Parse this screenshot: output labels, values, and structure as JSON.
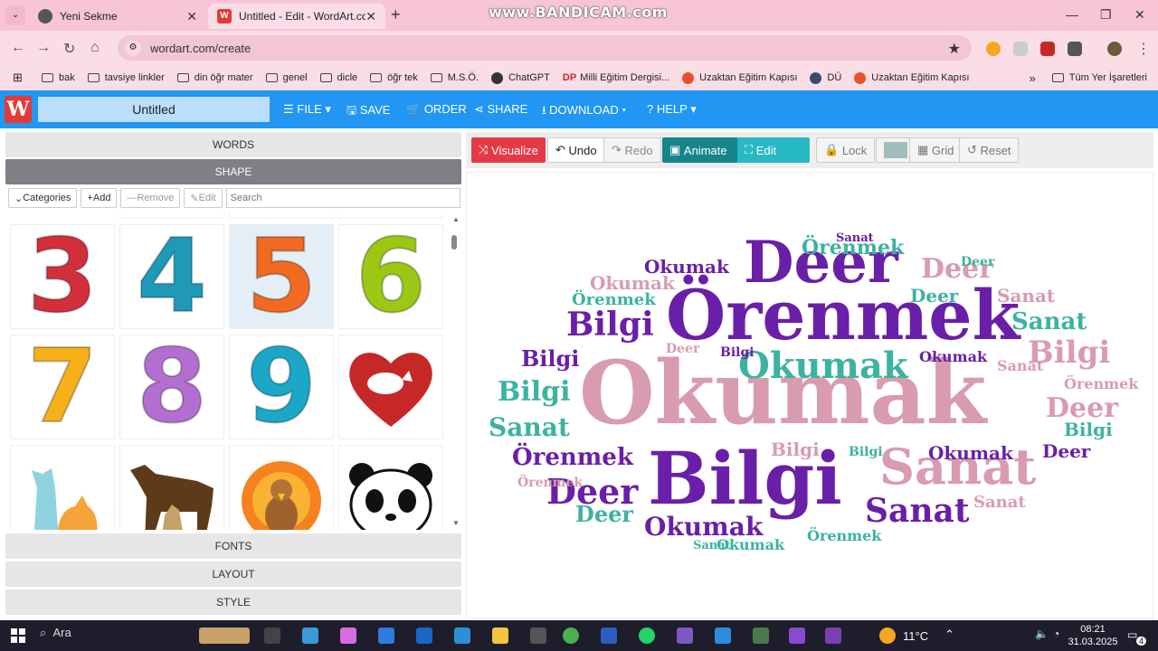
{
  "browser": {
    "tabs": [
      {
        "title": "Yeni Sekme"
      },
      {
        "title": "Untitled - Edit - WordArt.com"
      }
    ],
    "watermark": "www.BANDICAM.com",
    "url": "wordart.com/create",
    "bookmarks": [
      "bak",
      "tavsiye linkler",
      "din öğr mater",
      "genel",
      "dicle",
      "öğr tek",
      "M.S.Ö.",
      "ChatGPT",
      "Milli Eğitim Dergisi...",
      "Uzaktan Eğitim Kapısı",
      "DÜ",
      "Uzaktan Eğitim Kapısı"
    ],
    "all_bookmarks": "Tüm Yer İşaretleri"
  },
  "app": {
    "logo": "W",
    "title": "Untitled",
    "menu": [
      "FILE",
      "SAVE",
      "ORDER",
      "SHARE",
      "DOWNLOAD",
      "HELP"
    ]
  },
  "left": {
    "sections": {
      "words": "WORDS",
      "shape": "SHAPE",
      "fonts": "FONTS",
      "layout": "LAYOUT",
      "style": "STYLE"
    },
    "toolbar": {
      "categories": "Categories",
      "add": "Add",
      "remove": "Remove",
      "edit": "Edit",
      "search_placeholder": "Search"
    },
    "shapes": [
      {
        "glyph": "3",
        "color": "#d32f3a"
      },
      {
        "glyph": "4",
        "color": "#1e9ab8"
      },
      {
        "glyph": "5",
        "color": "#f26a22"
      },
      {
        "glyph": "6",
        "color": "#9cc715"
      },
      {
        "glyph": "7",
        "color": "#f5b01a"
      },
      {
        "glyph": "8",
        "color": "#b36ed1"
      },
      {
        "glyph": "9",
        "color": "#1aa7c8"
      }
    ]
  },
  "right": {
    "toolbar": {
      "visualize": "Visualize",
      "undo": "Undo",
      "redo": "Redo",
      "animate": "Animate",
      "edit": "Edit",
      "lock": "Lock",
      "grid": "Grid",
      "reset": "Reset"
    },
    "colors": {
      "visualize": "#e53946",
      "animate": "#17848b",
      "edit": "#27b9c4",
      "swatch": "#9fbfbf"
    },
    "cloud": {
      "words": [
        {
          "text": "Okumak",
          "color": "#d89bb0"
        },
        {
          "text": "Örenmek",
          "color": "#6a1fa8"
        },
        {
          "text": "Deer",
          "color": "#6a1fa8"
        },
        {
          "text": "Bilgi",
          "color": "#6a1fa8"
        },
        {
          "text": "Sanat",
          "color": "#d89bb0"
        },
        {
          "text": "Sanat",
          "color": "#6a1fa8"
        },
        {
          "text": "Okumak",
          "color": "#3bb3a0"
        },
        {
          "text": "Örenmek",
          "color": "#3bb3a0"
        },
        {
          "text": "Deer",
          "color": "#d89bb0"
        },
        {
          "text": "Bilgi",
          "color": "#6a1fa8"
        },
        {
          "text": "Bilgi",
          "color": "#d89bb0"
        },
        {
          "text": "Sanat",
          "color": "#3bb3a0"
        },
        {
          "text": "Bilgi",
          "color": "#3bb3a0"
        },
        {
          "text": "Sanat",
          "color": "#3bb3a0"
        },
        {
          "text": "Örenmek",
          "color": "#6a1fa8"
        },
        {
          "text": "Deer",
          "color": "#6a1fa8"
        },
        {
          "text": "Okumak",
          "color": "#6a1fa8"
        },
        {
          "text": "Deer",
          "color": "#3bb3a0"
        },
        {
          "text": "Okumak",
          "color": "#6a1fa8"
        },
        {
          "text": "Deer",
          "color": "#d89bb0"
        },
        {
          "text": "Sanat",
          "color": "#3bb3a0"
        },
        {
          "text": "Örenmek",
          "color": "#3bb3a0"
        },
        {
          "text": "Okumak",
          "color": "#6a1fa8"
        },
        {
          "text": "Deer",
          "color": "#3bb3a0"
        },
        {
          "text": "Bilgi",
          "color": "#6a1fa8"
        },
        {
          "text": "Sanat",
          "color": "#d89bb0"
        },
        {
          "text": "Örenmek",
          "color": "#3bb3a0"
        },
        {
          "text": "Okumak",
          "color": "#3bb3a0"
        },
        {
          "text": "Deer",
          "color": "#6a1fa8"
        },
        {
          "text": "Bilgi",
          "color": "#3bb3a0"
        },
        {
          "text": "Örenmek",
          "color": "#d89bb0"
        },
        {
          "text": "Sanat",
          "color": "#6a1fa8"
        },
        {
          "text": "Bilgi",
          "color": "#3bb3a0"
        },
        {
          "text": "Deer",
          "color": "#d89bb0"
        },
        {
          "text": "Okumak",
          "color": "#d89bb0"
        },
        {
          "text": "Sanat",
          "color": "#d89bb0"
        },
        {
          "text": "Örenmek",
          "color": "#d89bb0"
        },
        {
          "text": "Bilgi",
          "color": "#d89bb0"
        },
        {
          "text": "Deer",
          "color": "#3bb3a0"
        },
        {
          "text": "Okumak",
          "color": "#6a1fa8"
        },
        {
          "text": "Sanat",
          "color": "#3bb3a0"
        },
        {
          "text": "Bilgi",
          "color": "#6a1fa8"
        }
      ]
    }
  },
  "taskbar": {
    "search": "Ara",
    "weather": "11°C",
    "time": "08:21",
    "date": "31.03.2025",
    "notifications": "4"
  }
}
